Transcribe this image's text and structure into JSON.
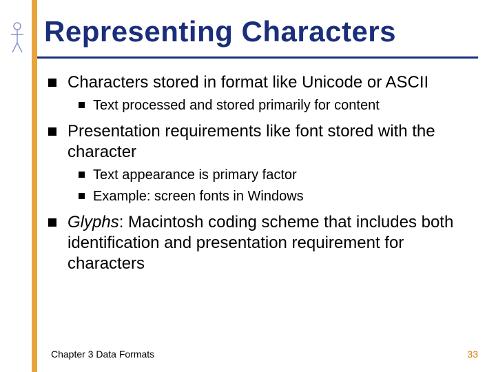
{
  "title": "Representing Characters",
  "bullets": {
    "b1": "Characters stored in format like Unicode or ASCII",
    "b1a": "Text processed and stored primarily for content",
    "b2": "Presentation requirements like font stored with the character",
    "b2a": "Text appearance is primary factor",
    "b2b": "Example: screen fonts in Windows",
    "b3_em": "Glyphs",
    "b3_rest": ":  Macintosh coding scheme that includes both identification and presentation requirement for characters"
  },
  "footer": {
    "left": "Chapter 3 Data Formats",
    "page": "33"
  }
}
